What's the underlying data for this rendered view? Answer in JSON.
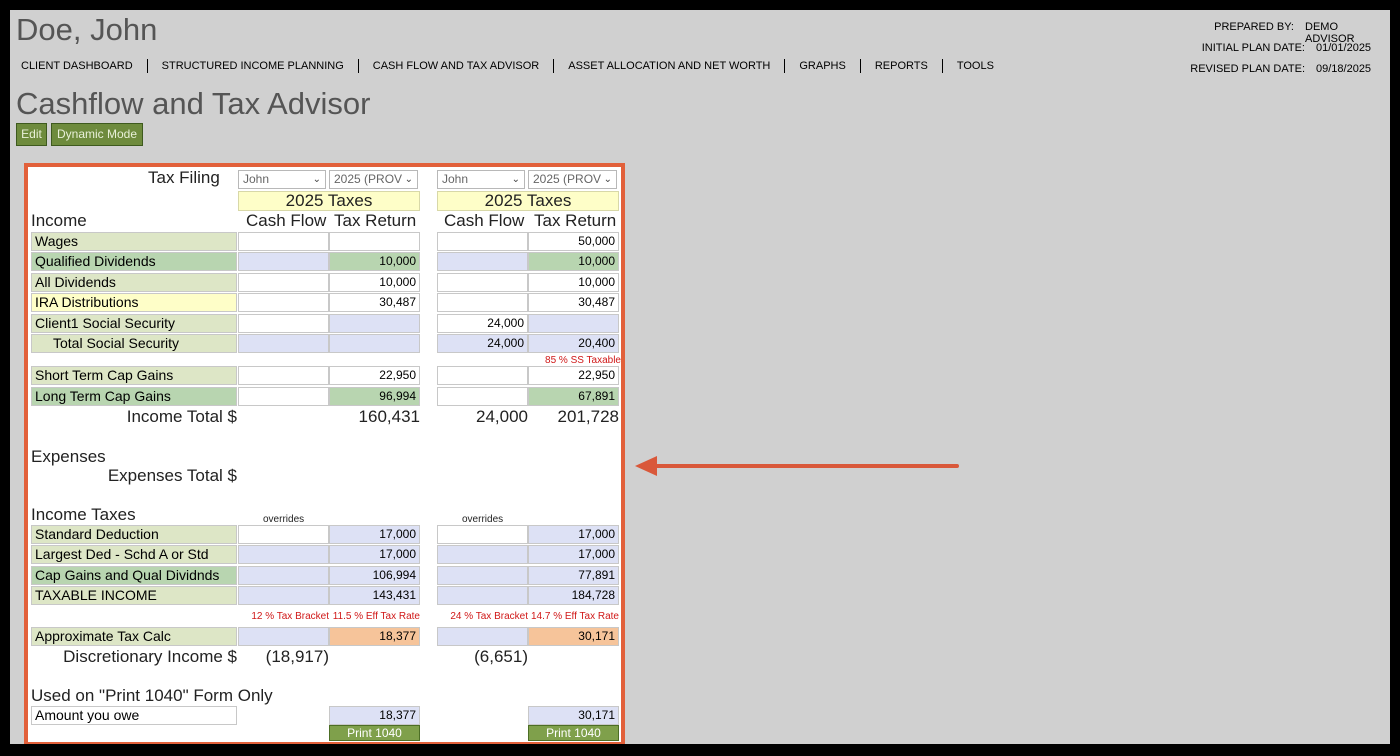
{
  "client_name": "Doe, John",
  "nav": [
    "CLIENT DASHBOARD",
    "STRUCTURED INCOME PLANNING",
    "CASH FLOW AND TAX ADVISOR",
    "ASSET ALLOCATION AND NET WORTH",
    "GRAPHS",
    "REPORTS",
    "TOOLS"
  ],
  "prepared": {
    "prepared_by_label": "PREPARED BY:",
    "prepared_by": "DEMO ADVISOR",
    "initial_label": "INITIAL PLAN DATE:",
    "initial": "01/01/2025",
    "revised_label": "REVISED PLAN DATE:",
    "revised": "09/18/2025"
  },
  "page_title": "Cashflow and Tax Advisor",
  "buttons": {
    "edit": "Edit",
    "dynamic": "Dynamic Mode"
  },
  "panel": {
    "tax_filing_label": "Tax Filing",
    "selects": {
      "person1": "John",
      "year1": "2025 (PROV",
      "person2": "John",
      "year2": "2025 (PROV"
    },
    "year_label_1": "2025 Taxes",
    "year_label_2": "2025 Taxes",
    "col_cash_flow": "Cash Flow",
    "col_tax_return": "Tax Return",
    "income_header": "Income",
    "edges": {
      "wages": "1",
      "qual": "3",
      "alldiv": "3",
      "ira": "4",
      "ss1": "6",
      "ssT": "6",
      "st": "7",
      "lt": "7",
      "inc": "1",
      "lded": "1",
      "ti": "1",
      "atc": "2",
      "owe": "3"
    },
    "rows": {
      "wages": {
        "label": "Wages",
        "c": "",
        "d": "",
        "e": "",
        "f": "50,000"
      },
      "qual": {
        "label": "Qualified Dividends",
        "c": "",
        "d": "10,000",
        "e": "",
        "f": "10,000"
      },
      "alldiv": {
        "label": "All Dividends",
        "c": "",
        "d": "10,000",
        "e": "",
        "f": "10,000"
      },
      "ira": {
        "label": "IRA Distributions",
        "c": "",
        "d": "30,487",
        "e": "",
        "f": "30,487"
      },
      "ss1": {
        "label": "Client1 Social Security",
        "c": "",
        "d": "",
        "e": "24,000",
        "f": ""
      },
      "ssT": {
        "label": "Total Social Security",
        "c": "",
        "d": "",
        "e": "24,000",
        "f": "20,400"
      },
      "st": {
        "label": "Short Term Cap Gains",
        "c": "",
        "d": "22,950",
        "e": "",
        "f": "22,950"
      },
      "lt": {
        "label": "Long Term Cap Gains",
        "c": "",
        "d": "96,994",
        "e": "",
        "f": "67,891"
      }
    },
    "ss_note": "85 % SS Taxable",
    "income_total_label": "Income Total $",
    "income_totals": {
      "d": "160,431",
      "e": "24,000",
      "f": "201,728"
    },
    "expenses_header": "Expenses",
    "expenses_total_label": "Expenses Total $",
    "income_taxes_header": "Income Taxes",
    "overrides": "overrides",
    "tax_rows": {
      "std": {
        "label": "Standard Deduction",
        "c": "",
        "d": "17,000",
        "e": "",
        "f": "17,000"
      },
      "lded": {
        "label": "Largest Ded - Schd A or Std",
        "c": "",
        "d": "17,000",
        "e": "",
        "f": "17,000"
      },
      "cgq": {
        "label": "Cap Gains and Qual Dividnds",
        "c": "",
        "d": "106,994",
        "e": "",
        "f": "77,891"
      },
      "ti": {
        "label": "TAXABLE INCOME",
        "c": "",
        "d": "143,431",
        "e": "",
        "f": "184,728"
      }
    },
    "bracket_1": "12 % Tax Bracket",
    "eff_rate_1": "11.5 % Eff Tax Rate",
    "bracket_2": "24 % Tax Bracket",
    "eff_rate_2": "14.7 % Eff Tax Rate",
    "atc": {
      "label": "Approximate Tax Calc",
      "c": "",
      "d": "18,377",
      "e": "",
      "f": "30,171"
    },
    "discretionary_label": "Discretionary Income $",
    "discretionary": {
      "c": "(18,917)",
      "e": "(6,651)"
    },
    "print_header": "Used on \"Print 1040\" Form Only",
    "owe": {
      "label": "Amount you owe",
      "d": "18,377",
      "f": "30,171"
    },
    "print_label": "Print 1040"
  },
  "colors": {
    "accent_border": "#e2603a",
    "arrow": "#d9583a",
    "button_green": "#6e8b3d"
  }
}
